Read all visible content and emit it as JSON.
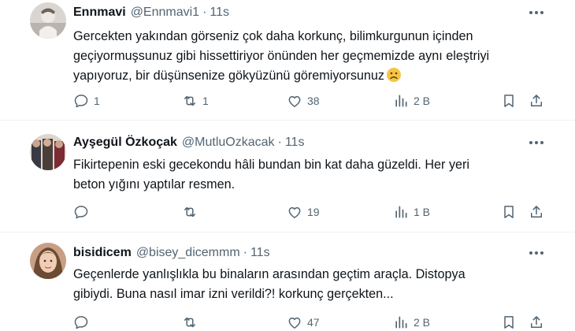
{
  "tweets": [
    {
      "name": "Ennmavi",
      "handle": "@Ennmavi1",
      "dot": "·",
      "time": "11s",
      "text_lines": [
        "Gercekten yakından görseniz çok daha korkunç, bilimkurgunun içinden",
        "geçiyormuşsunuz gibi hissettiriyor önünden her geçmemizde aynı eleştriyi",
        "yapıyoruz, bir düşünsenize gökyüzünü göremiyorsunuz"
      ],
      "emoji": "frowning-face",
      "replies": "1",
      "retweets": "1",
      "likes": "38",
      "views": "2 B"
    },
    {
      "name": "Ayşegül Özkoçak",
      "handle": "@MutluOzkacak",
      "dot": "·",
      "time": "11s",
      "text_lines": [
        "Fikirtepenin eski gecekondu hâli bundan bin kat daha güzeldi. Her yeri",
        "beton yığını yaptılar resmen."
      ],
      "replies": "",
      "retweets": "",
      "likes": "19",
      "views": "1 B"
    },
    {
      "name": "bisidicem",
      "handle": "@bisey_dicemmm",
      "dot": "·",
      "time": "11s",
      "text_lines": [
        "Geçenlerde yanlışlıkla bu binaların arasından geçtim araçla. Distopya",
        "gibiydi. Buna nasıl imar izni verildi?! korkunç gerçekten..."
      ],
      "replies": "",
      "retweets": "",
      "likes": "47",
      "views": "2 B"
    }
  ],
  "icons": {
    "reply": "reply-icon",
    "retweet": "retweet-icon",
    "like": "like-icon",
    "views": "views-icon",
    "bookmark": "bookmark-icon",
    "share": "share-icon",
    "more": "more-icon"
  },
  "colors": {
    "text": "#0f1419",
    "secondary": "#536471",
    "divider": "#eff3f4"
  }
}
